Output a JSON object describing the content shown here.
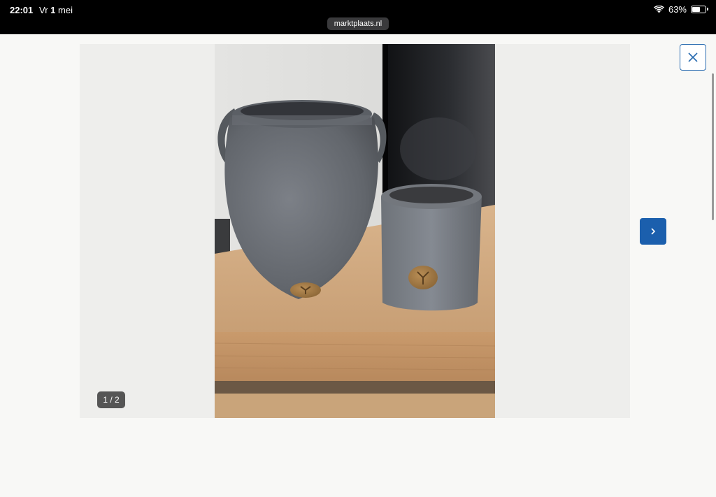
{
  "status_bar": {
    "time": "22:01",
    "date_prefix": "Vr",
    "date_day": "1",
    "date_month": "mei",
    "battery": "63%",
    "battery_level": 0.63,
    "url": "marktplaats.nl"
  },
  "gallery": {
    "counter": "1 / 2",
    "image_alt": "two grey ceramic pots on a wooden shelf"
  },
  "icons": {
    "close": "close-icon",
    "next": "chevron-right-icon",
    "wifi": "wifi-icon",
    "battery": "battery-icon"
  },
  "colors": {
    "accent": "#1b5fad",
    "close_border": "#2a6cb0",
    "background": "#f8f8f6"
  }
}
